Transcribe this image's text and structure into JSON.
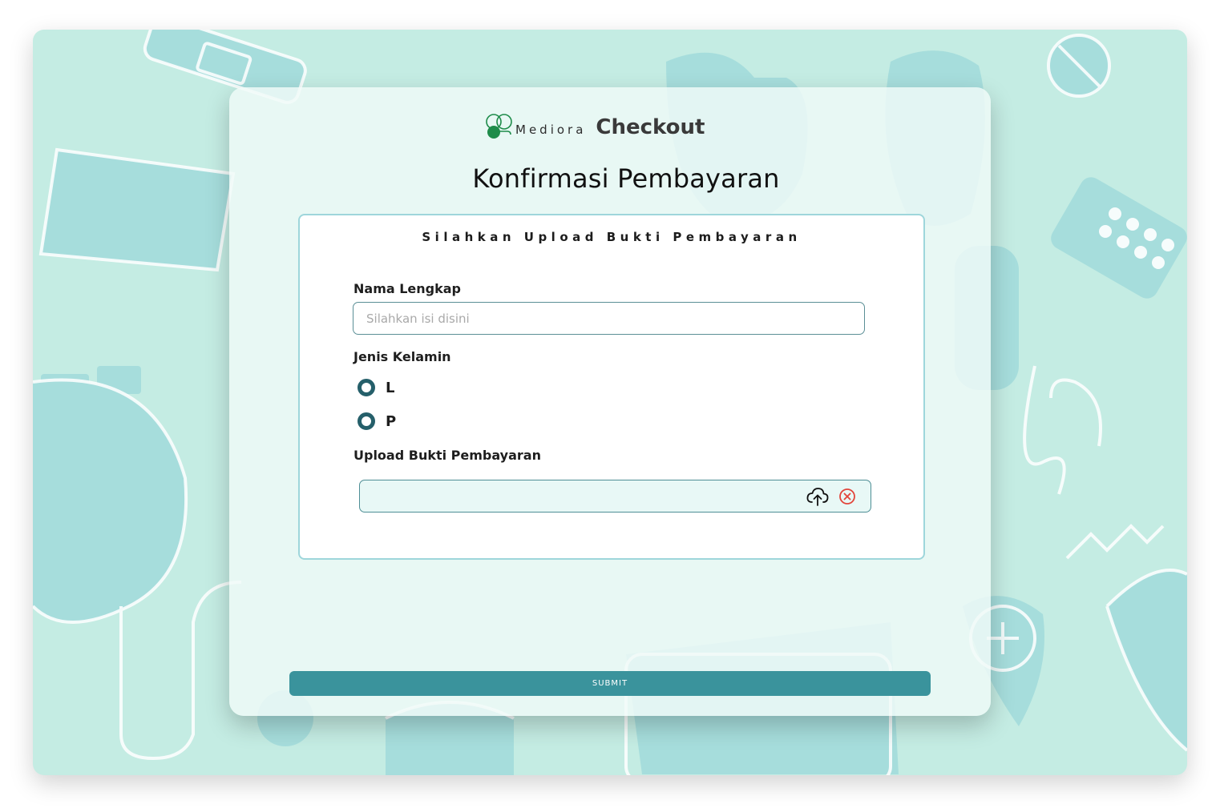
{
  "brand": {
    "name": "Mediora",
    "checkout": "Checkout"
  },
  "page": {
    "title": "Konfirmasi Pembayaran"
  },
  "form": {
    "heading": "Silahkan Upload Bukti Pembayaran",
    "name_field": {
      "label": "Nama Lengkap",
      "placeholder": "Silahkan isi disini",
      "value": ""
    },
    "gender": {
      "label": "Jenis Kelamin",
      "options": [
        "L",
        "P"
      ]
    },
    "upload": {
      "label": "Upload Bukti Pembayaran",
      "upload_icon": "cloud-upload-icon",
      "clear_icon": "close-circle-icon"
    },
    "submit_label": "SUBMIT"
  },
  "colors": {
    "background": "#c4ece3",
    "accent": "#3a939c",
    "brand_green": "#1e8c4a",
    "radio": "#255f6a",
    "clear": "#e2453b"
  }
}
